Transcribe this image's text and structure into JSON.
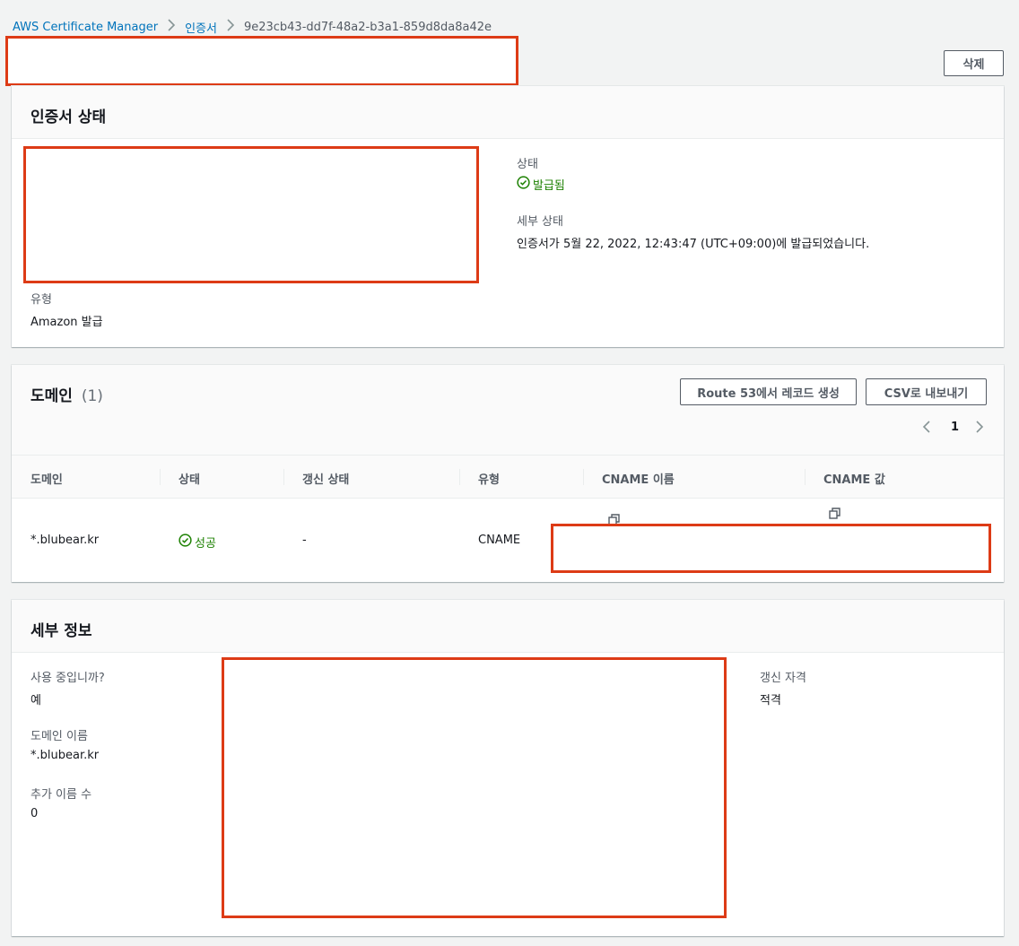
{
  "breadcrumb": {
    "service": "AWS Certificate Manager",
    "section": "인증서",
    "current": "9e23cb43-dd7f-48a2-b3a1-859d8da8a42e"
  },
  "header": {
    "delete_label": "삭제"
  },
  "status_panel": {
    "title": "인증서 상태",
    "status_label": "상태",
    "status_value": "발급됨",
    "detail_status_label": "세부 상태",
    "detail_status_value": "인증서가 5월 22, 2022, 12:43:47 (UTC+09:00)에 발급되었습니다.",
    "type_label": "유형",
    "type_value": "Amazon 발급"
  },
  "domain_panel": {
    "title": "도메인",
    "count": "(1)",
    "route53_label": "Route 53에서 레코드 생성",
    "csv_label": "CSV로 내보내기",
    "page_number": "1",
    "columns": [
      "도메인",
      "상태",
      "갱신 상태",
      "유형",
      "CNAME 이름",
      "CNAME 값"
    ],
    "rows": [
      {
        "domain": "*.blubear.kr",
        "status": "성공",
        "renewal": "-",
        "type": "CNAME"
      }
    ]
  },
  "detail_panel": {
    "title": "세부 정보",
    "in_use_label": "사용 중입니까?",
    "in_use_value": "예",
    "domain_name_label": "도메인 이름",
    "domain_name_value": "*.blubear.kr",
    "additional_names_label": "추가 이름 수",
    "additional_names_value": "0",
    "renewal_eligibility_label": "갱신 자격",
    "renewal_eligibility_value": "적격"
  },
  "colors": {
    "accent_link": "#0073bb",
    "success": "#1d8102",
    "redaction": "#dd3b16"
  },
  "icons": [
    "chevron-right-icon",
    "check-circle-icon",
    "chevron-left-icon",
    "copy-icon"
  ]
}
